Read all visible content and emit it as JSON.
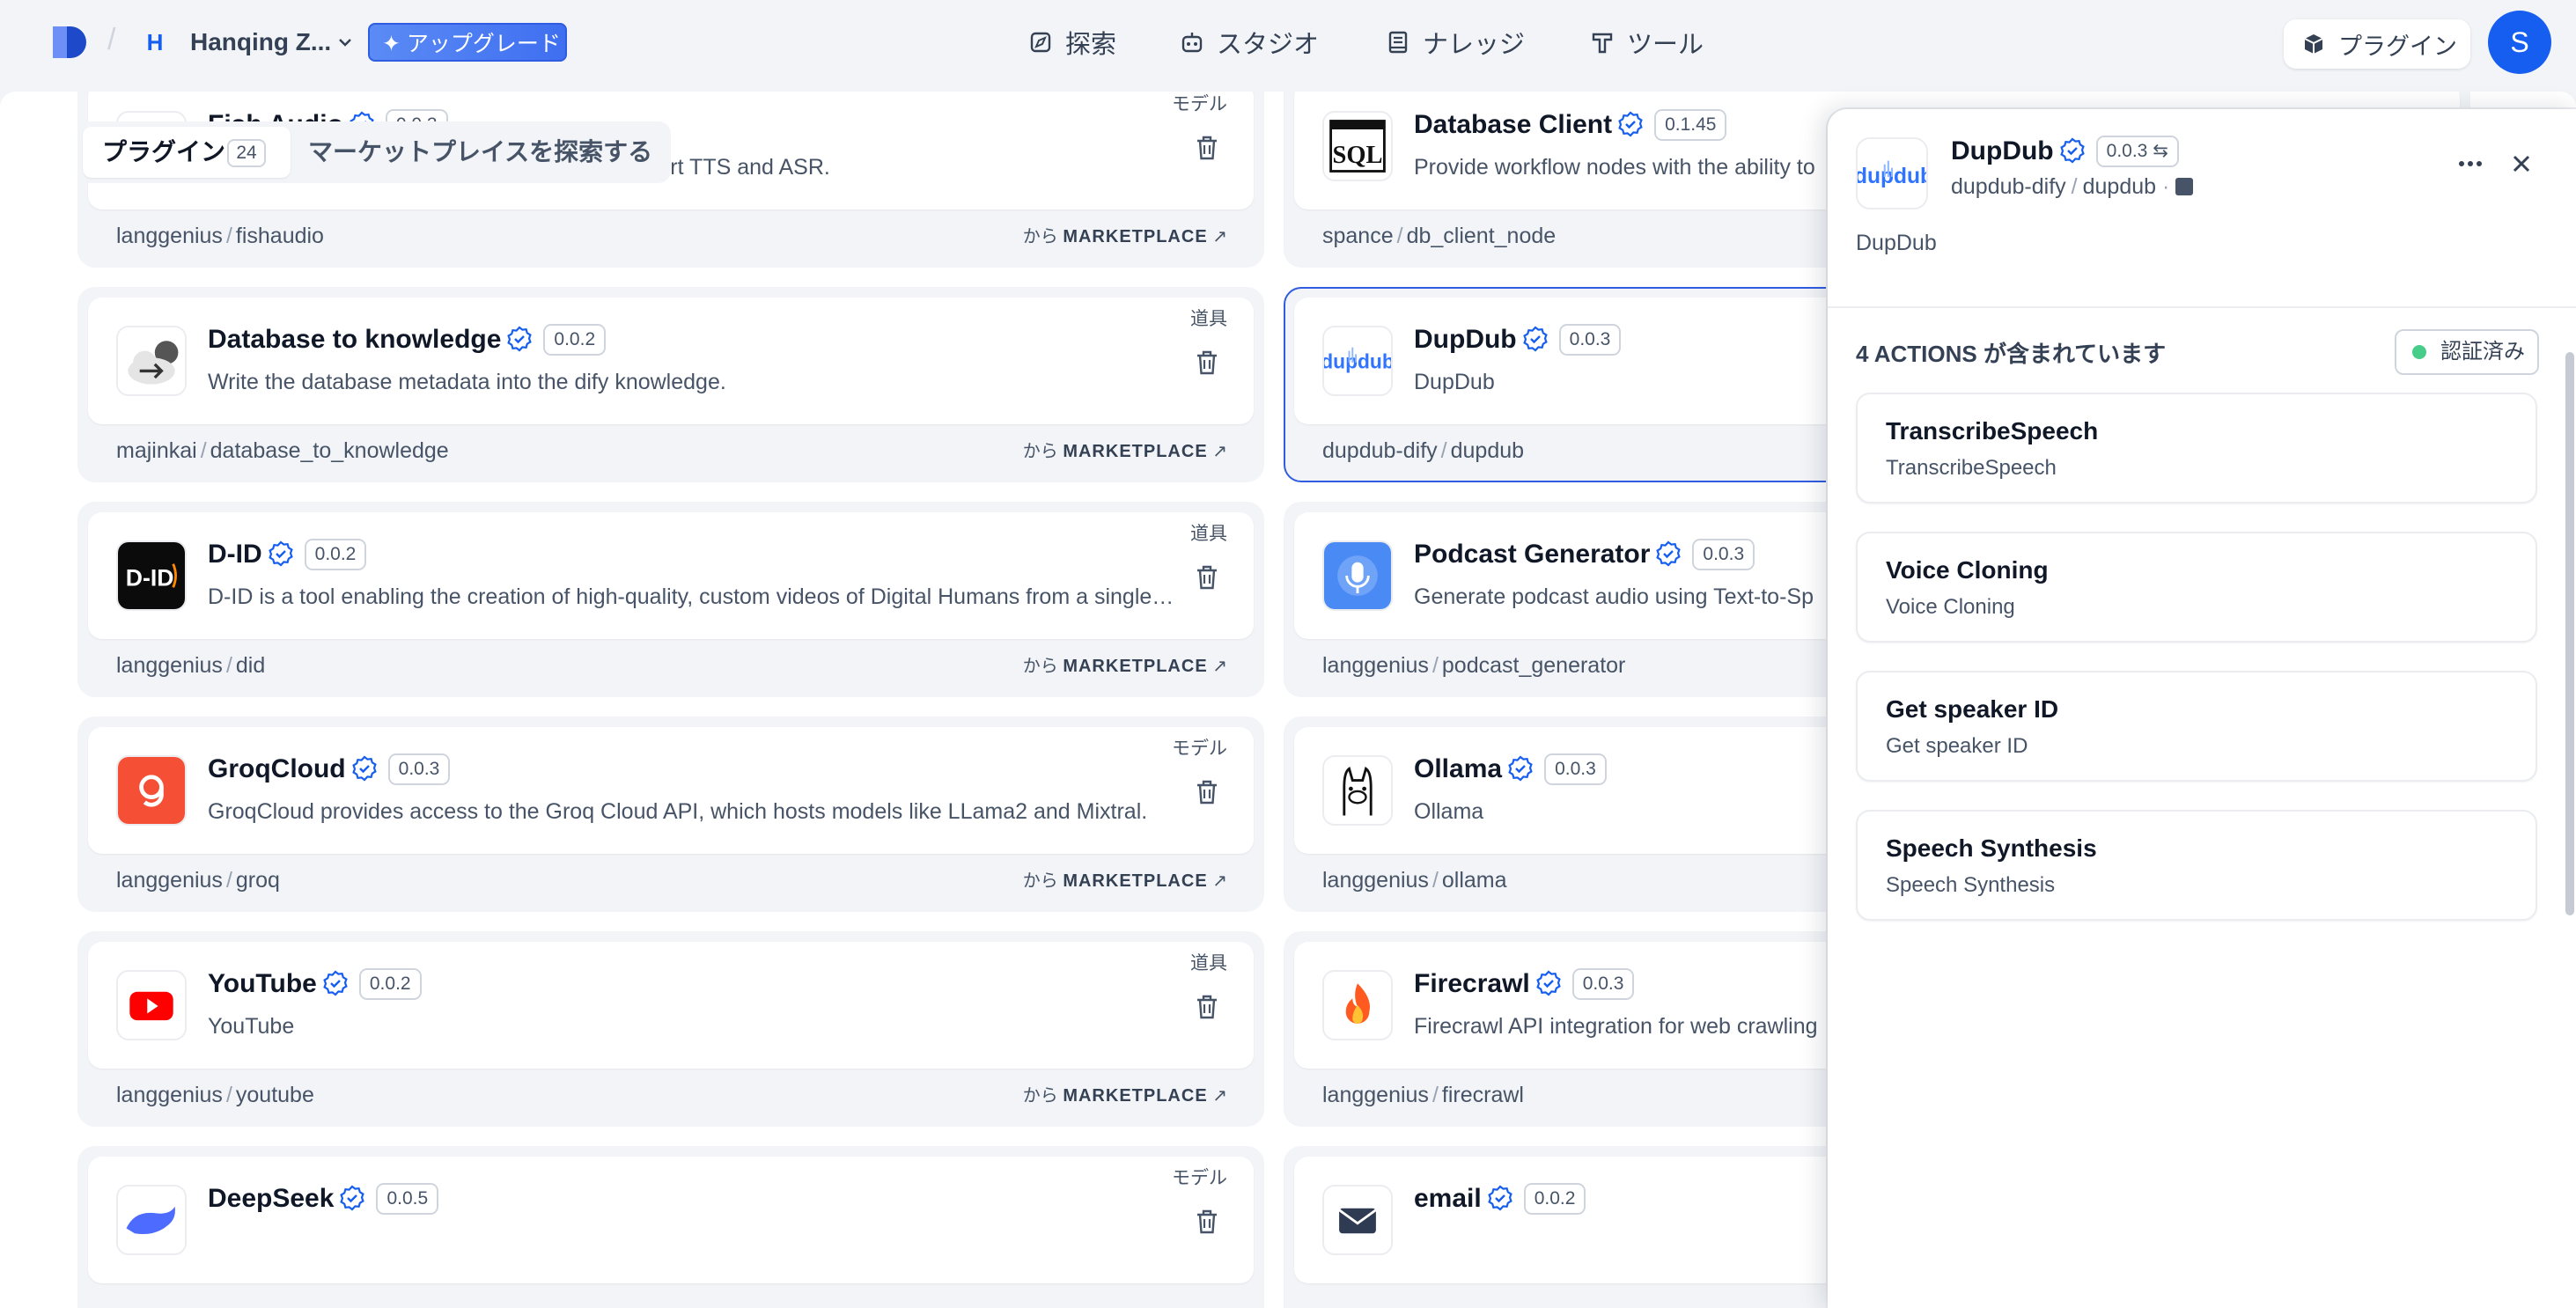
{
  "header": {
    "workspace_initial": "H",
    "workspace_name": "Hanqing Z...",
    "upgrade_label": "アップグレード",
    "nav": [
      {
        "label": "探索",
        "icon": "compass-icon"
      },
      {
        "label": "スタジオ",
        "icon": "robot-icon"
      },
      {
        "label": "ナレッジ",
        "icon": "book-icon"
      },
      {
        "label": "ツール",
        "icon": "hammer-icon"
      }
    ],
    "plugin_button": "プラグイン",
    "avatar_initial": "S"
  },
  "tabs": {
    "plugins_label": "プラグイン",
    "plugins_count": "24",
    "marketplace_label": "マーケットプレイスを探索する"
  },
  "cards": [
    {
      "name": "Fish Audio",
      "version": "0.0.3",
      "desc": "Models provided by Fish Audio, currently support TTS and ASR.",
      "author": "langgenius",
      "slug": "fishaudio",
      "tag": "モデル",
      "icon": "fish-audio-logo",
      "source_prefix": "から",
      "source": "MARKETPLACE"
    },
    {
      "name": "Database Client",
      "version": "0.1.45",
      "desc": "Provide workflow nodes with the ability to",
      "author": "spance",
      "slug": "db_client_node",
      "tag": "",
      "icon": "sql-icon",
      "source_prefix": "",
      "source": ""
    },
    {
      "name": "Database to knowledge",
      "version": "0.0.2",
      "desc": "Write the database metadata into the dify knowledge.",
      "author": "majinkai",
      "slug": "database_to_knowledge",
      "tag": "道具",
      "icon": "cloud-upload-icon",
      "source_prefix": "から",
      "source": "MARKETPLACE"
    },
    {
      "name": "DupDub",
      "version": "0.0.3",
      "desc": "DupDub",
      "author": "dupdub-dify",
      "slug": "dupdub",
      "tag": "",
      "icon": "dupdub-logo",
      "source_prefix": "",
      "source": ""
    },
    {
      "name": "D-ID",
      "version": "0.0.2",
      "desc": "D-ID is a tool enabling the creation of high-quality, custom videos of Digital Humans from a single image",
      "author": "langgenius",
      "slug": "did",
      "tag": "道具",
      "icon": "did-logo",
      "source_prefix": "から",
      "source": "MARKETPLACE"
    },
    {
      "name": "Podcast Generator",
      "version": "0.0.3",
      "desc": "Generate podcast audio using Text-to-Sp",
      "author": "langgenius",
      "slug": "podcast_generator",
      "tag": "",
      "icon": "microphone-icon",
      "source_prefix": "",
      "source": ""
    },
    {
      "name": "GroqCloud",
      "version": "0.0.3",
      "desc": "GroqCloud provides access to the Groq Cloud API, which hosts models like LLama2 and Mixtral.",
      "author": "langgenius",
      "slug": "groq",
      "tag": "モデル",
      "icon": "groq-logo",
      "source_prefix": "から",
      "source": "MARKETPLACE"
    },
    {
      "name": "Ollama",
      "version": "0.0.3",
      "desc": "Ollama",
      "author": "langgenius",
      "slug": "ollama",
      "tag": "",
      "icon": "llama-icon",
      "source_prefix": "",
      "source": ""
    },
    {
      "name": "YouTube",
      "version": "0.0.2",
      "desc": "YouTube",
      "author": "langgenius",
      "slug": "youtube",
      "tag": "道具",
      "icon": "youtube-logo",
      "source_prefix": "から",
      "source": "MARKETPLACE"
    },
    {
      "name": "Firecrawl",
      "version": "0.0.3",
      "desc": "Firecrawl API integration for web crawling",
      "author": "langgenius",
      "slug": "firecrawl",
      "tag": "",
      "icon": "fire-icon",
      "source_prefix": "",
      "source": ""
    },
    {
      "name": "DeepSeek",
      "version": "0.0.5",
      "desc": "",
      "author": "",
      "slug": "",
      "tag": "モデル",
      "icon": "whale-icon",
      "source_prefix": "",
      "source": ""
    },
    {
      "name": "email",
      "version": "0.0.2",
      "desc": "",
      "author": "",
      "slug": "",
      "tag": "",
      "icon": "mail-icon",
      "source_prefix": "",
      "source": ""
    }
  ],
  "detail": {
    "name": "DupDub",
    "version": "0.0.3",
    "org": "dupdub-dify",
    "plugin": "dupdub",
    "description": "DupDub",
    "actions_heading": "4 ACTIONS が含まれています",
    "auth_badge": "認証済み",
    "actions": [
      {
        "title": "TranscribeSpeech",
        "subtitle": "TranscribeSpeech"
      },
      {
        "title": "Voice Cloning",
        "subtitle": "Voice Cloning"
      },
      {
        "title": "Get speaker ID",
        "subtitle": "Get speaker ID"
      },
      {
        "title": "Speech Synthesis",
        "subtitle": "Speech Synthesis"
      }
    ]
  },
  "colors": {
    "accent": "#155eef",
    "verified": "#155eef",
    "auth_dot": "#47cd89",
    "youtube": "#ff0000",
    "groq": "#f55036"
  }
}
